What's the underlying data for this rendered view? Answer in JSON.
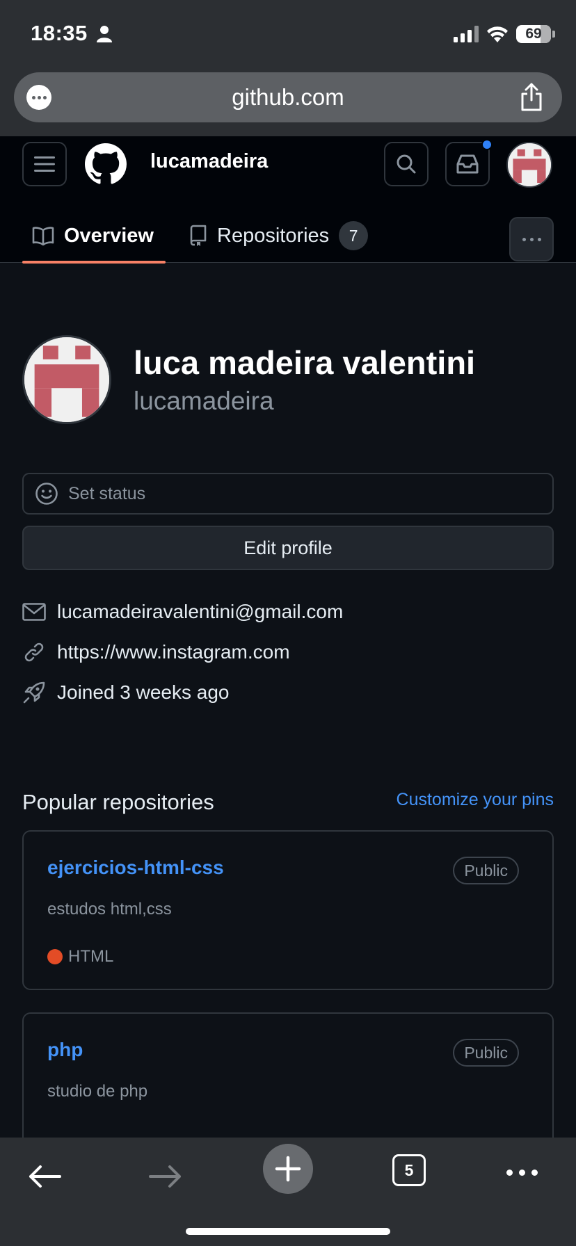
{
  "status_bar": {
    "time": "18:35",
    "battery": "69"
  },
  "browser": {
    "url": "github.com"
  },
  "header": {
    "username": "lucamadeira",
    "icons": [
      "menu-icon",
      "github-logo-icon",
      "search-icon",
      "inbox-icon",
      "avatar"
    ]
  },
  "tabs": [
    {
      "label": "Overview",
      "icon": "book-icon",
      "selected": true
    },
    {
      "label": "Repositories",
      "icon": "repo-icon",
      "count": "7"
    }
  ],
  "profile": {
    "full_name": "luca madeira valentini",
    "login": "lucamadeira",
    "set_status": "Set status",
    "edit_profile": "Edit profile",
    "email": "lucamadeiravalentini@gmail.com",
    "website": "https://www.instagram.com",
    "joined": "Joined 3 weeks ago"
  },
  "popular": {
    "title": "Popular repositories",
    "customize_link": "Customize your pins",
    "repos": [
      {
        "name": "ejercicios-html-css",
        "visibility": "Public",
        "description": "estudos html,css",
        "language": "HTML",
        "language_color": "#e34c26"
      },
      {
        "name": "php",
        "visibility": "Public",
        "description": "studio de php"
      }
    ]
  },
  "bottom_toolbar": {
    "tab_count": "5"
  },
  "colors": {
    "background": "#0d1117",
    "header": "#010409",
    "link": "#4493f8",
    "tab_underline": "#f78166",
    "notification_dot": "#2f81f7"
  }
}
